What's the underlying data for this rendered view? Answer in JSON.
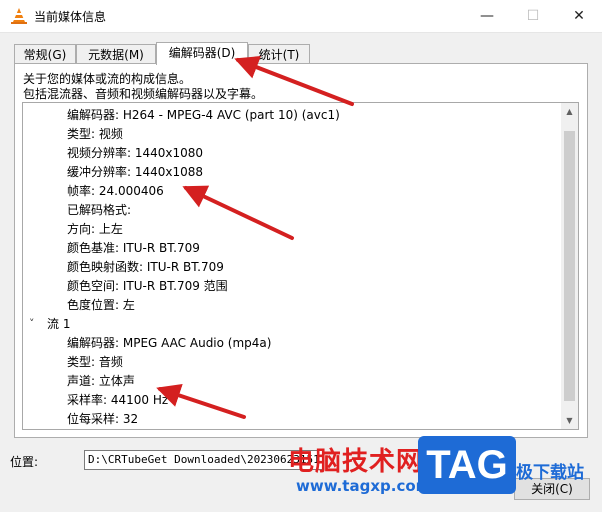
{
  "window": {
    "title": "当前媒体信息",
    "minimize": "—",
    "maximize": "☐",
    "close": "✕"
  },
  "tabs": [
    {
      "label": "常规(G)"
    },
    {
      "label": "元数据(M)"
    },
    {
      "label": "编解码器(D)"
    },
    {
      "label": "统计(T)"
    }
  ],
  "description": [
    "关于您的媒体或流的构成信息。",
    "包括混流器、音频和视频编解码器以及字幕。"
  ],
  "video_rows": [
    "编解码器: H264 - MPEG-4 AVC (part 10) (avc1)",
    "类型: 视频",
    "视频分辨率: 1440x1080",
    "缓冲分辨率: 1440x1088",
    "帧率: 24.000406",
    "已解码格式:",
    "方向: 上左",
    "颜色基准: ITU-R BT.709",
    "颜色映射函数: ITU-R BT.709",
    "颜色空间: ITU-R BT.709 范围",
    "色度位置: 左"
  ],
  "stream1": {
    "label": "流 1",
    "rows": [
      "编解码器: MPEG AAC Audio (mp4a)",
      "类型: 音频",
      "声道: 立体声",
      "采样率: 44100 Hz",
      "位每采样: 32"
    ]
  },
  "location": {
    "label": "位置:",
    "value": "D:\\CRTubeGet Downloaded\\20230623151..."
  },
  "close_button": "关闭(C)",
  "watermark": {
    "text": "电脑技术网",
    "url": "www.tagxp.com",
    "logo": "TAG",
    "right": "极下载站"
  },
  "colors": {
    "arrow": "#d42020",
    "watermark_red": "#e02020",
    "watermark_blue": "#1e6bd6"
  }
}
